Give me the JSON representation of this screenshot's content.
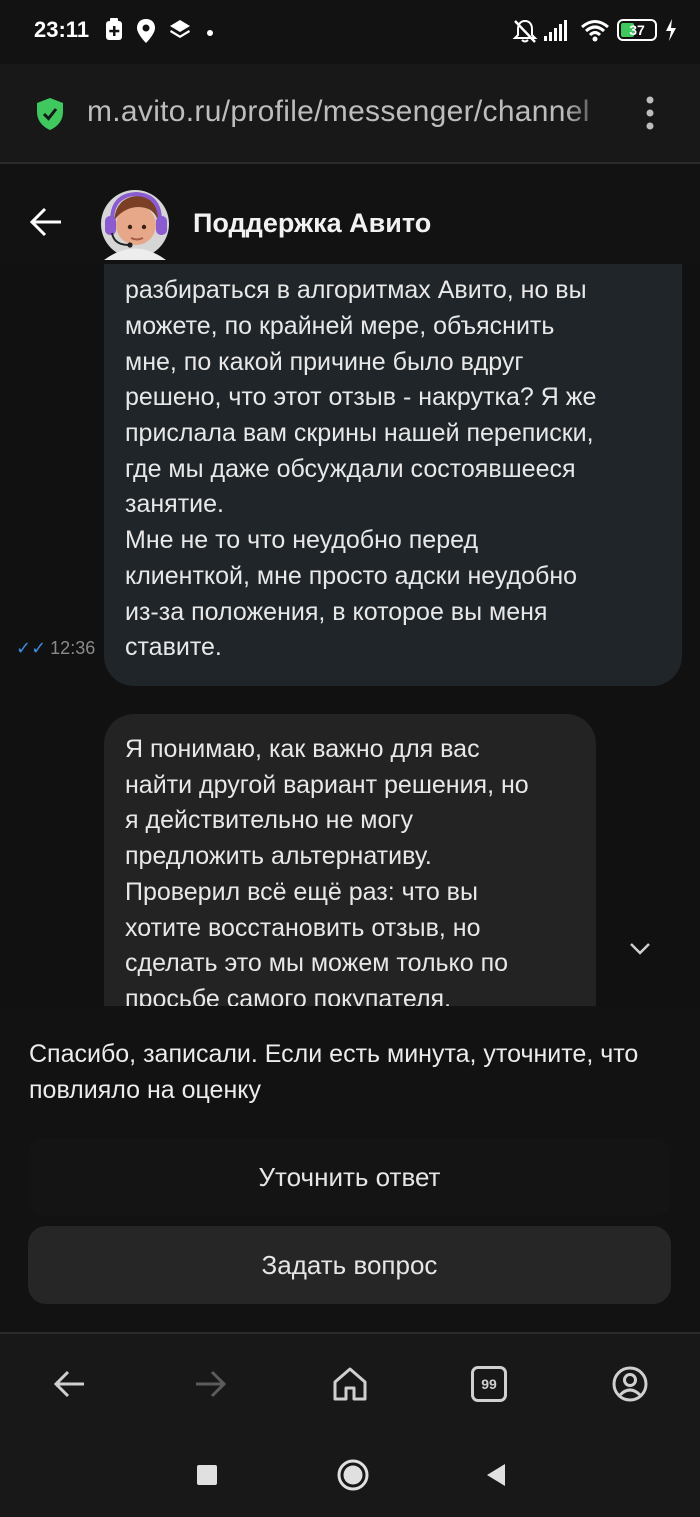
{
  "status_bar": {
    "time": "23:11",
    "battery": "37"
  },
  "browser": {
    "url": "m.avito.ru/profile/messenger/channel"
  },
  "chat": {
    "title": "Поддержка Авито",
    "user_message": {
      "lines": [
        "разбираться в алгоритмах Авито, но вы",
        "можете, по крайней мере, объяснить",
        "мне, по какой причине было вдруг",
        "решено, что этот отзыв - накрутка? Я же",
        "прислала вам скрины нашей переписки,",
        "где мы даже обсуждали состоявшееся",
        "занятие.",
        "Мне не то что неудобно перед",
        "клиенткой, мне просто адски неудобно",
        "из-за положения, в которое вы меня",
        "ставите."
      ],
      "time": "12:36"
    },
    "support_message": {
      "lines": [
        "Я понимаю, как важно для вас",
        "найти другой вариант решения, но",
        "я действительно не могу",
        "предложить альтернативу.",
        "Проверил всё ещё раз: что вы",
        "хотите восстановить отзыв, но",
        "сделать это мы можем только по",
        "просьбе самого покупателя."
      ]
    }
  },
  "feedback_sheet": {
    "text": "Спасибо, записали. Если есть минута, уточните, что повлияло на оценку",
    "clarify_button": "Уточнить ответ",
    "ask_button": "Задать вопрос"
  },
  "browser_nav": {
    "tabs_count": "99"
  },
  "colors": {
    "background": "#121212",
    "user_bubble": "#1f2528",
    "support_bubble": "#232323",
    "read_ticks": "#3a8de0",
    "secure_shield": "#3ec85e",
    "avatar_headset": "#8a5cd0"
  },
  "icons": [
    "do-not-disturb-icon",
    "location-icon",
    "layers-icon",
    "bell-off-icon",
    "signal-icon",
    "wifi-icon",
    "battery-icon",
    "shield-check-icon",
    "more-vert-icon",
    "back-arrow-icon",
    "avatar",
    "chevron-down-icon",
    "home-icon",
    "tabs-icon",
    "profile-icon",
    "square-icon",
    "circle-icon",
    "triangle-back-icon"
  ]
}
